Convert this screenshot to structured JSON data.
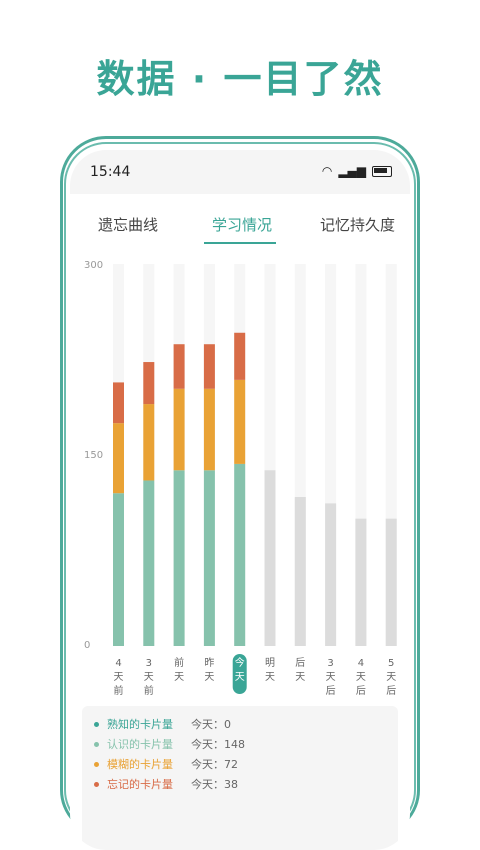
{
  "headline": "数据 · 一目了然",
  "status": {
    "time": "15:44"
  },
  "tabs": [
    "遗忘曲线",
    "学习情况",
    "记忆持久度"
  ],
  "active_tab": 1,
  "colors": {
    "green": "#86c2ac",
    "orange": "#e9a235",
    "red": "#d86c47",
    "future": "#dcdcdc",
    "track": "#f6f6f6",
    "accent": "#3aa596"
  },
  "chart_data": {
    "type": "bar",
    "stacked": true,
    "ylim": [
      0,
      300
    ],
    "yticks": [
      "0",
      "150",
      "300"
    ],
    "categories": [
      [
        "4",
        "天",
        "前"
      ],
      [
        "3",
        "天",
        "前"
      ],
      [
        "前",
        "天"
      ],
      [
        "昨",
        "天"
      ],
      [
        "今",
        "天"
      ],
      [
        "明",
        "天"
      ],
      [
        "后",
        "天"
      ],
      [
        "3",
        "天",
        "后"
      ],
      [
        "4",
        "天",
        "后"
      ],
      [
        "5",
        "天",
        "后"
      ]
    ],
    "highlight_index": 4,
    "series": [
      {
        "values": [
          120,
          130,
          138,
          138,
          143
        ]
      },
      {
        "values": [
          55,
          60,
          64,
          64,
          66
        ]
      },
      {
        "values": [
          32,
          33,
          35,
          35,
          37
        ]
      }
    ],
    "future_values": [
      138,
      117,
      112,
      100,
      100
    ]
  },
  "legend": [
    {
      "label": "熟知的卡片量",
      "value": "今天：0",
      "color": "#3aa596"
    },
    {
      "label": "认识的卡片量",
      "value": "今天：148",
      "color": "#86c2ac"
    },
    {
      "label": "模糊的卡片量",
      "value": "今天：72",
      "color": "#e9a235"
    },
    {
      "label": "忘记的卡片量",
      "value": "今天：38",
      "color": "#d86c47"
    }
  ]
}
